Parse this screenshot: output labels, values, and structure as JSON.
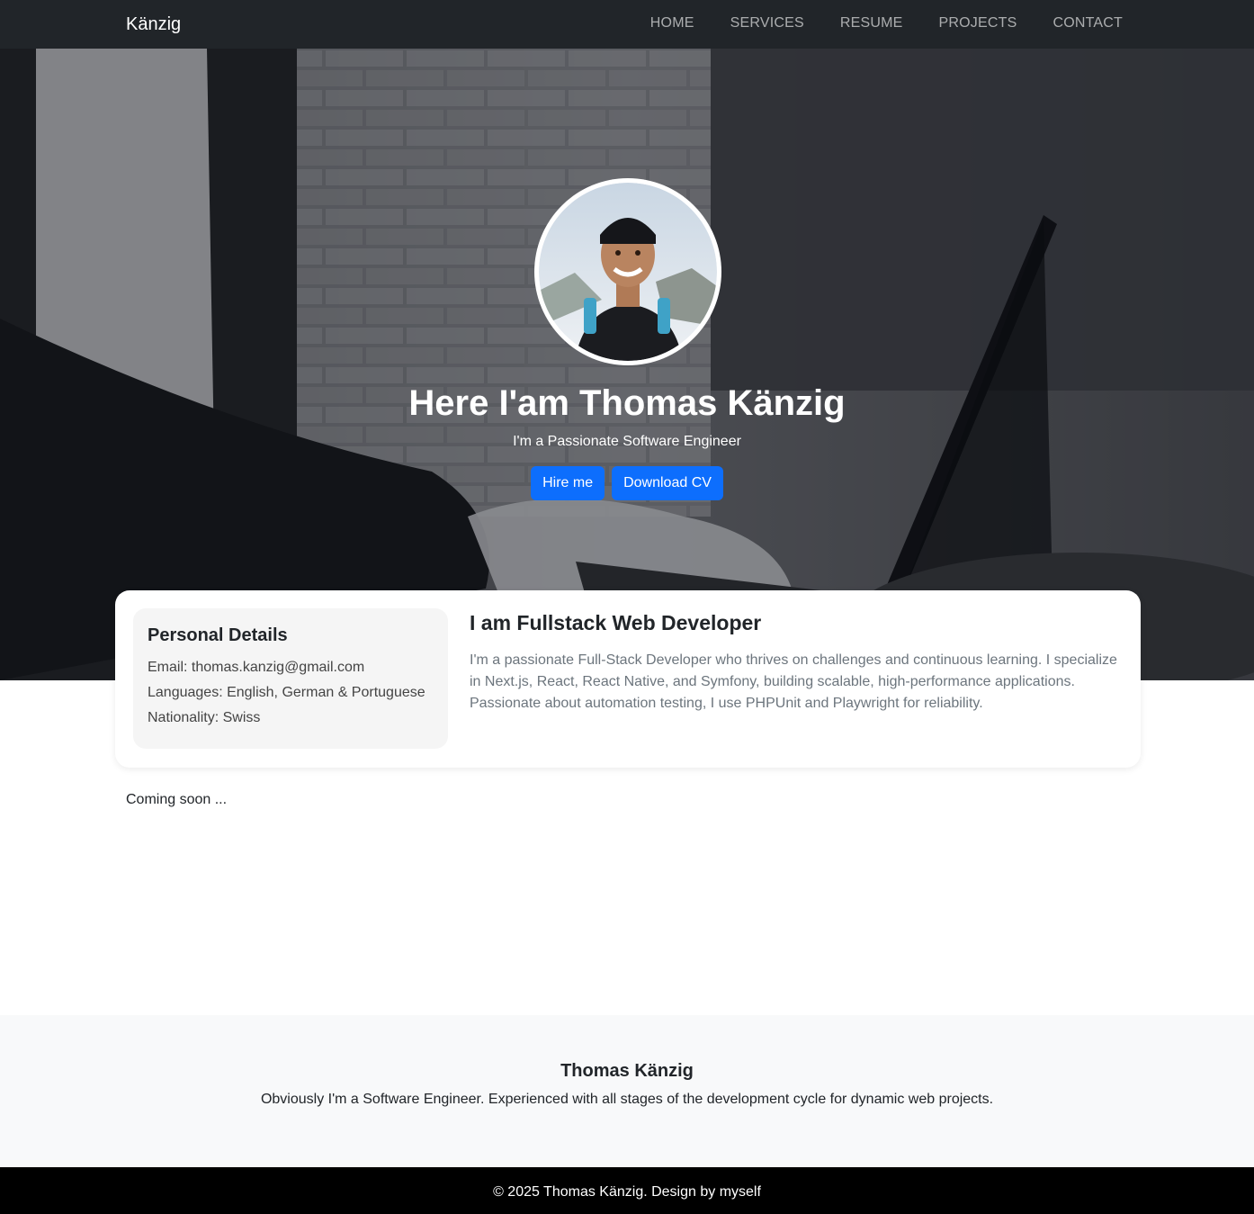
{
  "navbar": {
    "brand": "Känzig",
    "links": [
      "HOME",
      "SERVICES",
      "RESUME",
      "PROJECTS",
      "CONTACT"
    ]
  },
  "hero": {
    "title": "Here I'am Thomas Känzig",
    "subtitle": "I'm a Passionate Software Engineer",
    "buttons": {
      "hire": "Hire me",
      "download": "Download CV"
    }
  },
  "about": {
    "details_title": "Personal Details",
    "email": "Email: thomas.kanzig@gmail.com",
    "languages": "Languages: English, German & Portuguese",
    "nationality": "Nationality: Swiss",
    "heading": "I am Fullstack Web Developer",
    "body": "I'm a passionate Full-Stack Developer who thrives on challenges and continuous learning. I specialize in Next.js, React, React Native, and Symfony, building scalable, high-performance applications. Passionate about automation testing, I use PHPUnit and Playwright for reliability."
  },
  "main": {
    "coming_soon": "Coming soon ..."
  },
  "footer": {
    "name": "Thomas Känzig",
    "description": "Obviously I'm a Software Engineer. Experienced with all stages of the development cycle for dynamic web projects.",
    "copyright": "© 2025 Thomas Känzig. Design by myself"
  },
  "colors": {
    "navbar_bg": "#212529",
    "primary": "#0d6efd",
    "footer_info_bg": "#f8f9fa",
    "footer_bottom_bg": "#000000"
  }
}
